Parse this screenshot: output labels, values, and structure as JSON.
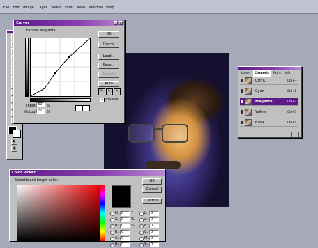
{
  "menu": [
    "File",
    "Edit",
    "Image",
    "Layer",
    "Select",
    "Filter",
    "View",
    "Window",
    "Help"
  ],
  "curves": {
    "title": "Curves",
    "channel_label": "Channel: Magenta",
    "buttons": {
      "ok": "OK",
      "cancel": "Cancel",
      "load": "Load...",
      "save": "Save...",
      "smooth": "Smooth",
      "auto": "Auto"
    },
    "input_label": "Input:",
    "input_value": "39",
    "input_unit": "%",
    "output_label": "Output:",
    "output_value": "22",
    "output_unit": "%",
    "preview_label": "Preview"
  },
  "channels": {
    "tabs": [
      "Layers",
      "Channels",
      "Paths",
      "Info"
    ],
    "rows": [
      {
        "name": "CMYK",
        "shortcut": "Ctrl+~"
      },
      {
        "name": "Cyan",
        "shortcut": "Ctrl+1"
      },
      {
        "name": "Magenta",
        "shortcut": "Ctrl+2"
      },
      {
        "name": "Yellow",
        "shortcut": "Ctrl+3"
      },
      {
        "name": "Black",
        "shortcut": "Ctrl+4"
      }
    ]
  },
  "color_picker": {
    "title": "Color Picker",
    "prompt": "Select black target color:",
    "buttons": {
      "ok": "OK",
      "cancel": "Cancel",
      "custom": "Custom"
    },
    "fields": [
      {
        "label": "H:",
        "value": "0",
        "unit": "°"
      },
      {
        "label": "S:",
        "value": "0",
        "unit": "%"
      },
      {
        "label": "B:",
        "value": "0",
        "unit": "%"
      },
      {
        "label": "R:",
        "value": "0",
        "unit": ""
      },
      {
        "label": "G:",
        "value": "0",
        "unit": ""
      },
      {
        "label": "B:",
        "value": "0",
        "unit": ""
      }
    ],
    "cmyk_fields": [
      {
        "label": "L:",
        "value": "0"
      },
      {
        "label": "a:",
        "value": "0"
      },
      {
        "label": "b:",
        "value": "0"
      },
      {
        "label": "C:",
        "value": "0"
      },
      {
        "label": "M:",
        "value": "0"
      },
      {
        "label": "Y:",
        "value": "0"
      }
    ]
  }
}
